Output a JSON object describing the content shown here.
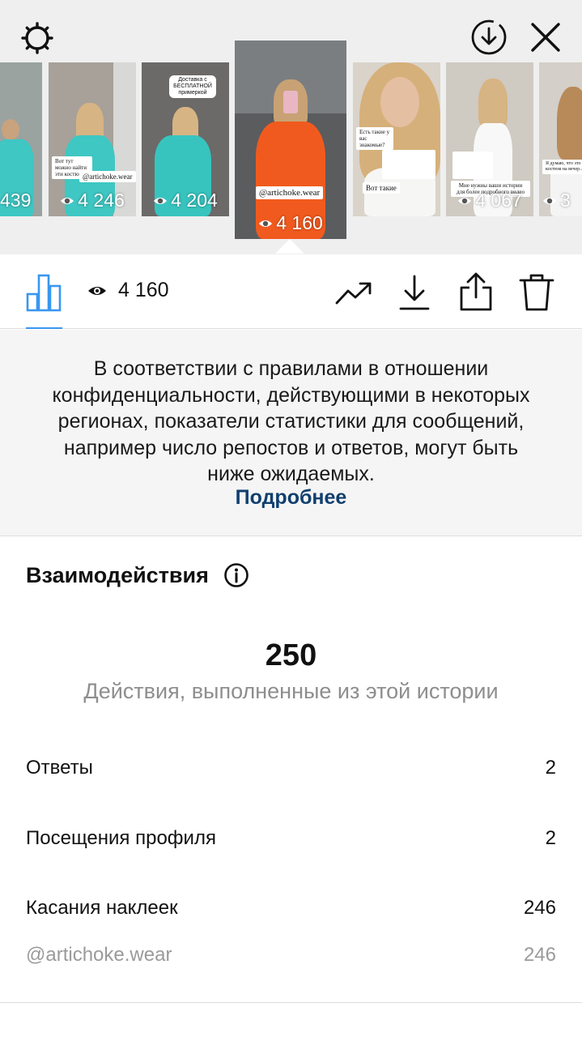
{
  "header": {
    "settings_icon": "gear-icon",
    "download_icon": "download-circle-icon",
    "close_icon": "close-icon"
  },
  "stories": [
    {
      "views": "439"
    },
    {
      "views": "4 246",
      "sticker_text": "Вот тут можно найти эти костюмы",
      "mention": "@artichoke.wear"
    },
    {
      "views": "4 204",
      "sticker_text": "Доставка с БЕСПЛАТНОЙ примеркой"
    },
    {
      "views": "4 160",
      "mention": "@artichoke.wear",
      "selected": true
    },
    {
      "views": "",
      "sticker_text": "Есть такие у вас знакомые?",
      "sticker_text_2": "Вот такие"
    },
    {
      "views": "4 067",
      "sticker_text": "Мне нужны ваши истории для более подробного видео"
    },
    {
      "views": "3",
      "sticker_text": "Я думаю, что это костюм на вечер..."
    }
  ],
  "toolbar": {
    "views_count": "4 160",
    "tab_icon": "bar-chart-icon",
    "eye_icon": "eye-icon",
    "actions": [
      "trending-icon",
      "download-icon",
      "share-icon",
      "trash-icon"
    ]
  },
  "notice": {
    "text": "В соответствии с правилами в отношении конфиденциальности, действующими в некоторых регионах, показатели статистики для сообщений, например число репостов и ответов, могут быть ниже ожидаемых.",
    "link": "Подробнее"
  },
  "interactions": {
    "title": "Взаимодействия",
    "total": "250",
    "caption": "Действия, выполненные из этой истории",
    "rows": [
      {
        "label": "Ответы",
        "value": "2"
      },
      {
        "label": "Посещения профиля",
        "value": "2"
      },
      {
        "label": "Касания наклеек",
        "value": "246"
      },
      {
        "label": "@artichoke.wear",
        "value": "246"
      }
    ]
  },
  "colors": {
    "accent": "#3897f0",
    "link": "#103f6e",
    "muted": "#8e8e8e"
  }
}
